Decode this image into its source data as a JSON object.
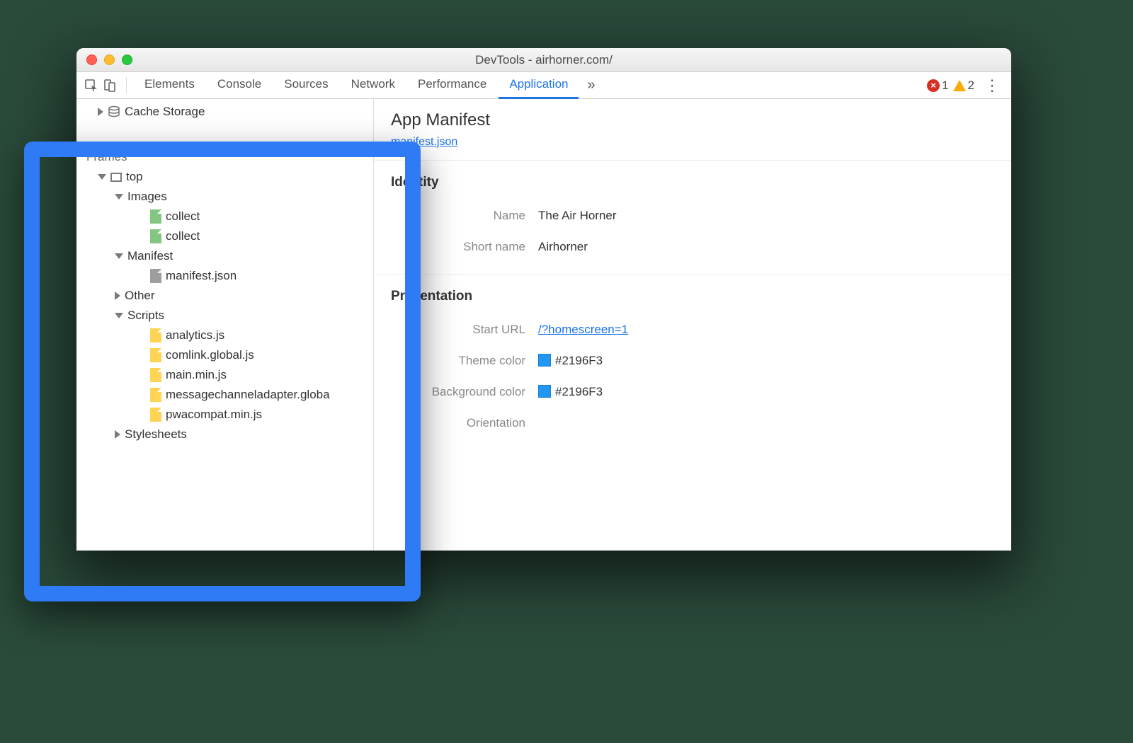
{
  "window": {
    "title": "DevTools - airhorner.com/"
  },
  "tabs": {
    "items": [
      "Elements",
      "Console",
      "Sources",
      "Network",
      "Performance",
      "Application"
    ],
    "active": "Application",
    "more": "»"
  },
  "status": {
    "errors": "1",
    "warnings": "2"
  },
  "sidebar": {
    "cache_storage": "Cache Storage",
    "frames_header": "Frames",
    "top": "top",
    "images": "Images",
    "images_items": [
      "collect",
      "collect"
    ],
    "manifest": "Manifest",
    "manifest_file": "manifest.json",
    "other": "Other",
    "scripts": "Scripts",
    "scripts_items": [
      "analytics.js",
      "comlink.global.js",
      "main.min.js",
      "messagechanneladapter.globa",
      "pwacompat.min.js"
    ],
    "stylesheets": "Stylesheets"
  },
  "manifest": {
    "title": "App Manifest",
    "file": "manifest.json",
    "identity_header": "Identity",
    "name_label": "Name",
    "name_value": "The Air Horner",
    "shortname_label": "Short name",
    "shortname_value": "Airhorner",
    "presentation_header": "Presentation",
    "starturl_label": "Start URL",
    "starturl_value": "/?homescreen=1",
    "themecolor_label": "Theme color",
    "themecolor_value": "#2196F3",
    "bgcolor_label": "Background color",
    "bgcolor_value": "#2196F3",
    "orientation_label": "Orientation",
    "orientation_value": ""
  },
  "colors": {
    "theme": "#2196F3",
    "background": "#2196F3"
  }
}
